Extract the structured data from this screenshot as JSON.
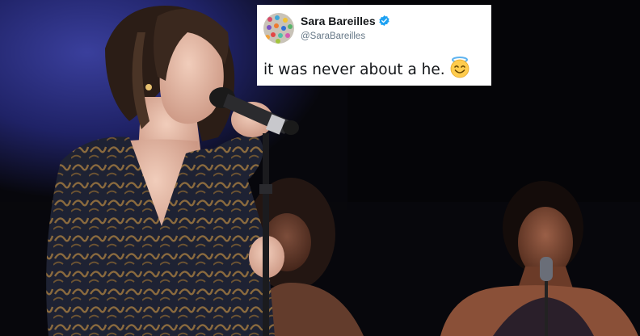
{
  "tweet": {
    "display_name": "Sara Bareilles",
    "handle": "@SaraBareilles",
    "text": "it was never about a he.",
    "verified_icon": "verified-badge-icon",
    "emoji": "smiling-face-with-halo",
    "colors": {
      "verified": "#1da1f2",
      "name": "#14171a",
      "handle": "#657786",
      "card": "#ffffff"
    }
  },
  "photo": {
    "subject": "singer-at-microphone-stand",
    "background_performer": "backup-singer"
  }
}
